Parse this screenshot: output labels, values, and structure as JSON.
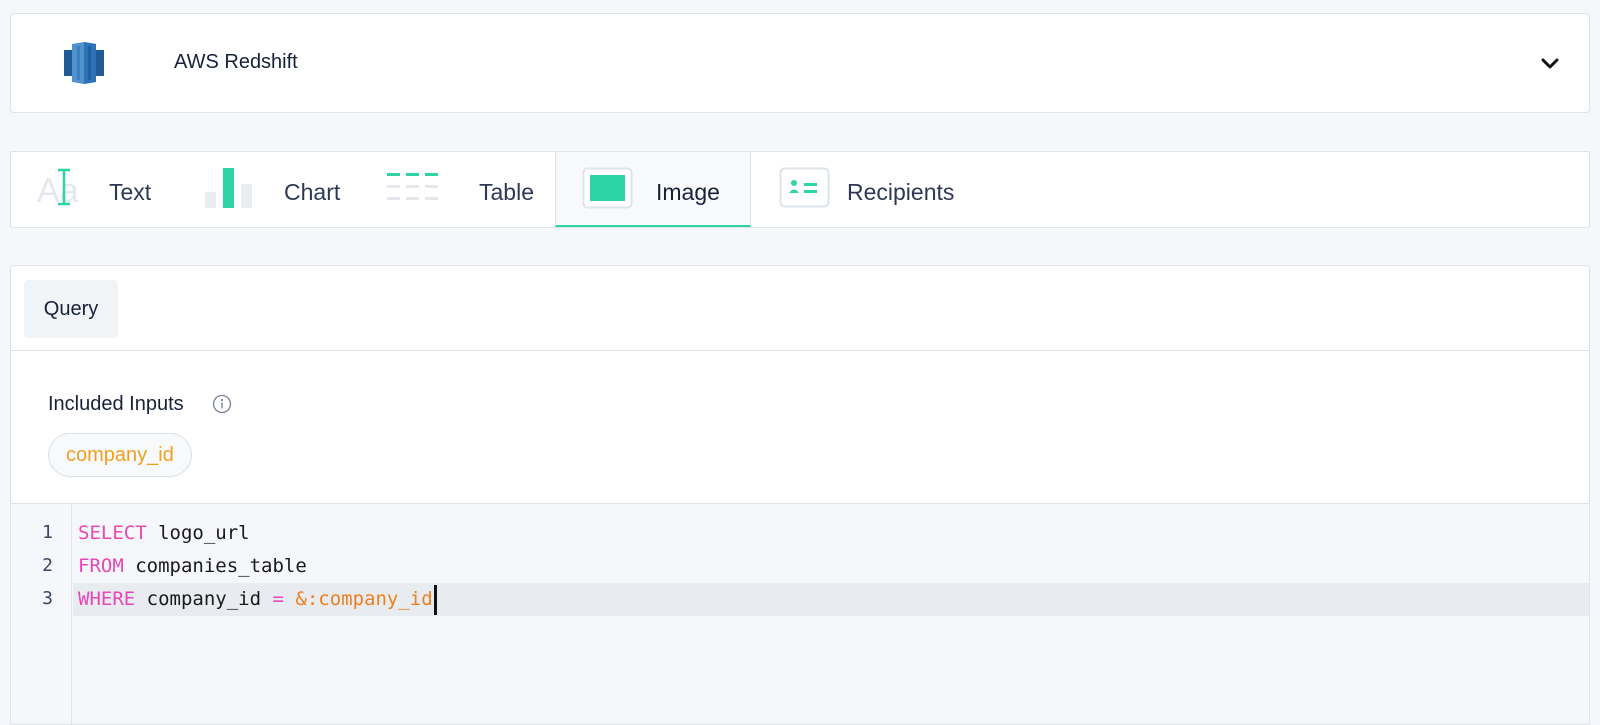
{
  "datasource": {
    "name": "AWS Redshift",
    "logo_icon": "aws-redshift-logo",
    "expand_icon": "chevron-down-icon"
  },
  "tabs": [
    {
      "label": "Text",
      "icon": "text-cursor-icon",
      "active": false
    },
    {
      "label": "Chart",
      "icon": "bar-chart-icon",
      "active": false
    },
    {
      "label": "Table",
      "icon": "table-icon",
      "active": false
    },
    {
      "label": "Image",
      "icon": "image-icon",
      "active": true
    },
    {
      "label": "Recipients",
      "icon": "recipients-card-icon",
      "active": false
    }
  ],
  "query": {
    "tab_label": "Query",
    "included_inputs_label": "Included Inputs",
    "inputs": [
      "company_id"
    ],
    "editor": {
      "line_numbers": [
        "1",
        "2",
        "3"
      ],
      "lines": [
        {
          "keyword": "SELECT",
          "rest": " logo_url"
        },
        {
          "keyword": "FROM",
          "rest": " companies_table"
        },
        {
          "keyword": "WHERE",
          "rest": " company_id ",
          "op": "=",
          "param": "&:company_id"
        }
      ]
    }
  },
  "colors": {
    "accent": "#2ed3a6",
    "keyword": "#e946b6",
    "param": "#ee7f1e",
    "chip_text": "#f0a021"
  }
}
